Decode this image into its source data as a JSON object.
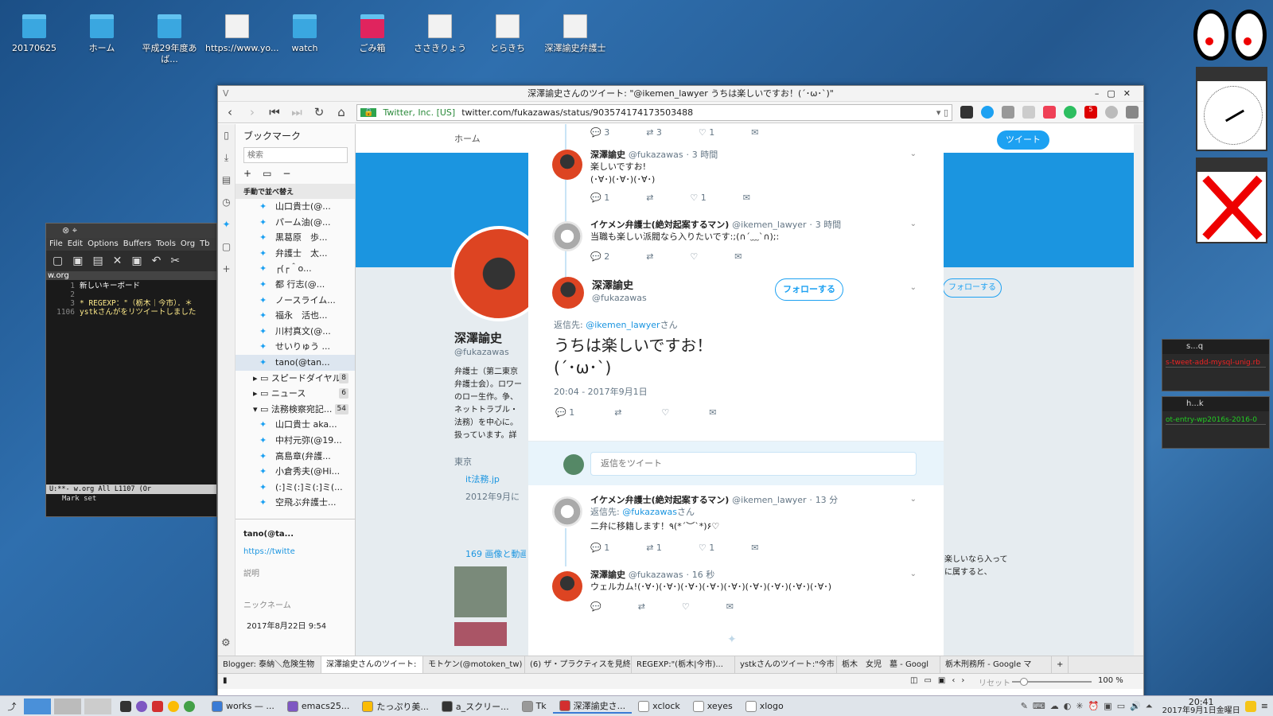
{
  "desktop": {
    "icons": [
      {
        "label": "20170625",
        "kind": "folder"
      },
      {
        "label": "ホーム",
        "kind": "folder"
      },
      {
        "label": "平成29年度あば...",
        "kind": "folder"
      },
      {
        "label": "https://www.yo...",
        "kind": "doc"
      },
      {
        "label": "watch",
        "kind": "folder"
      },
      {
        "label": "ごみ箱",
        "kind": "trash"
      },
      {
        "label": "ささきりょう",
        "kind": "doc"
      },
      {
        "label": "とらきち",
        "kind": "doc"
      },
      {
        "label": "深澤諭史弁護士",
        "kind": "doc"
      }
    ]
  },
  "browser": {
    "title": "深澤諭史さんのツイート: \"@ikemen_lawyer うちは楽しいですお！(´･ω･`)\"",
    "identity": "Twitter, Inc. [US]",
    "url": "twitter.com/fukazawas/status/903574174173503488",
    "ext_badge": "5",
    "sidebar": {
      "title": "ブックマーク",
      "search_placeholder": "検索",
      "sort_label": "手動で並べ替え",
      "items": [
        {
          "label": "山口貴士(@...",
          "kind": "tw"
        },
        {
          "label": "パーム油(@...",
          "kind": "tw"
        },
        {
          "label": "黒葛原　歩...",
          "kind": "tw"
        },
        {
          "label": "弁護士　太...",
          "kind": "tw"
        },
        {
          "label": "┌(┌＾o...",
          "kind": "tw"
        },
        {
          "label": "都 行志(@...",
          "kind": "tw"
        },
        {
          "label": "ノースライム...",
          "kind": "tw"
        },
        {
          "label": "福永　活也...",
          "kind": "tw"
        },
        {
          "label": "川村真文(@...",
          "kind": "tw"
        },
        {
          "label": "せいりゅう ...",
          "kind": "tw"
        },
        {
          "label": "tano(@tan...",
          "kind": "tw"
        },
        {
          "label": "スピードダイヤル",
          "kind": "folder",
          "count": "8"
        },
        {
          "label": "ニュース",
          "kind": "folder",
          "count": "6"
        },
        {
          "label": "法務検察宛記...",
          "kind": "folder",
          "count": "54"
        },
        {
          "label": "山口貴士 aka...",
          "kind": "tw"
        },
        {
          "label": "中村元弥(@19...",
          "kind": "tw"
        },
        {
          "label": "高島章(弁護...",
          "kind": "tw"
        },
        {
          "label": "小倉秀夫(@Hi...",
          "kind": "tw"
        },
        {
          "label": "(:]ミ(:]ミ(:]ミ(...",
          "kind": "tw"
        },
        {
          "label": "空飛ぶ弁護士...",
          "kind": "tw"
        }
      ],
      "detail": {
        "title": "tano(@ta...",
        "url": "https://twitte",
        "desc_label": "説明",
        "nick_label": "ニックネーム",
        "date": "2017年8月22日 9:54"
      }
    },
    "profile": {
      "nav_home": "ホーム",
      "name": "深澤諭史",
      "handle": "@fukazawas",
      "bio": "弁護士（第二東京弁護士会）。ロワーのロー生作。争、ネットトラブル・法務）を中心に。扱っています。詳しさい",
      "location": "東京",
      "site": "it法務.jp",
      "joined": "2012年9月に",
      "media": "169 画像と動画",
      "follow": "フォローする",
      "tweet_btn": "ツイート",
      "snippet1": "楽しいなら入って",
      "snippet2": "に属すると、"
    },
    "thread": [
      {
        "name": "深澤諭史",
        "handle": "@fukazawas",
        "time": "3 時間",
        "text1": "楽しいですお!",
        "text2": "(･∀･)(･∀･)(･∀･)",
        "reply": "1",
        "rt": "",
        "like": "1"
      },
      {
        "name": "イケメン弁護士(絶対起案するマン)",
        "handle": "@ikemen_lawyer",
        "time": "3 時間",
        "text1": "当職も楽しい派閥なら入りたいです:;(∩´﹏`∩);:",
        "reply": "2",
        "rt": "",
        "like": ""
      }
    ],
    "top_counts": {
      "reply": "3",
      "rt": "3",
      "like": "1"
    },
    "main": {
      "name": "深澤諭史",
      "handle": "@fukazawas",
      "follow": "フォローする",
      "reply_to_label": "返信先:",
      "reply_to": "@ikemen_lawyer",
      "reply_suffix": "さん",
      "text1": "うちは楽しいですお！",
      "text2": "(´･ω･`)",
      "timestamp": "20:04 - 2017年9月1日",
      "reply": "1"
    },
    "reply_placeholder": "返信をツイート",
    "replies": [
      {
        "name": "イケメン弁護士(絶対起案するマン)",
        "handle": "@ikemen_lawyer",
        "time": "13 分",
        "reply_to_label": "返信先:",
        "reply_to": "@fukazawas",
        "reply_suffix": "さん",
        "text": "二弁に移籍します！٩(*´︶`*)۶♡",
        "reply": "1",
        "rt": "1",
        "like": "1"
      },
      {
        "name": "深澤諭史",
        "handle": "@fukazawas",
        "time": "16 秒",
        "text": "ウェルカム!(･∀･)(･∀･)(･∀･)(･∀･)(･∀･)(･∀･)(･∀･)(･∀･)(･∀･)",
        "reply": "",
        "rt": "",
        "like": ""
      }
    ],
    "tabs": [
      "Blogger: 泰納＼危険生物",
      "深澤諭史さんのツイート:",
      "モトケン(@motoken_tw)",
      "(6) ザ・プラクティスを見終",
      "REGEXP:\"(栃木|今市)...",
      "ystkさんのツイート:\"今市",
      "栃木　女児　墓 - Googl",
      "栃木刑務所 - Google マ"
    ],
    "status": {
      "reset": "リセット",
      "zoom": "100 %"
    }
  },
  "emacs": {
    "title": "emacs",
    "menu": [
      "File",
      "Edit",
      "Options",
      "Buffers",
      "Tools",
      "Org",
      "Tb"
    ],
    "buffer": "w.org",
    "lines": [
      {
        "n": "1",
        "t": "新しいキーボード"
      },
      {
        "n": "2",
        "t": ""
      },
      {
        "n": "3",
        "t": "* REGEXP：\"（栃木｜今市）．＊"
      },
      {
        "n": "1106",
        "t": "ystkさんがをリツイートしました"
      }
    ],
    "modeline": "U:**-  w.org      All L1107  (Or",
    "minibuffer": "Mark set"
  },
  "panels": [
    {
      "title": "s...q",
      "content": "s-tweet-add-mysql-unig.rb"
    },
    {
      "title": "h...k",
      "content": "ot-entry-wp2016s-2016-0"
    }
  ],
  "taskbar": {
    "items": [
      "works — ...",
      "emacs25...",
      "たっぷり美...",
      "a_スクリー...",
      "Tk",
      "深澤諭史さ...",
      "xclock",
      "xeyes",
      "xlogo"
    ],
    "time": "20:41",
    "date": "2017年9月1日金曜日"
  },
  "colors": {
    "twitter_blue": "#1da1f2",
    "header_blue": "#1b95e0",
    "link": "#1b95e0"
  }
}
